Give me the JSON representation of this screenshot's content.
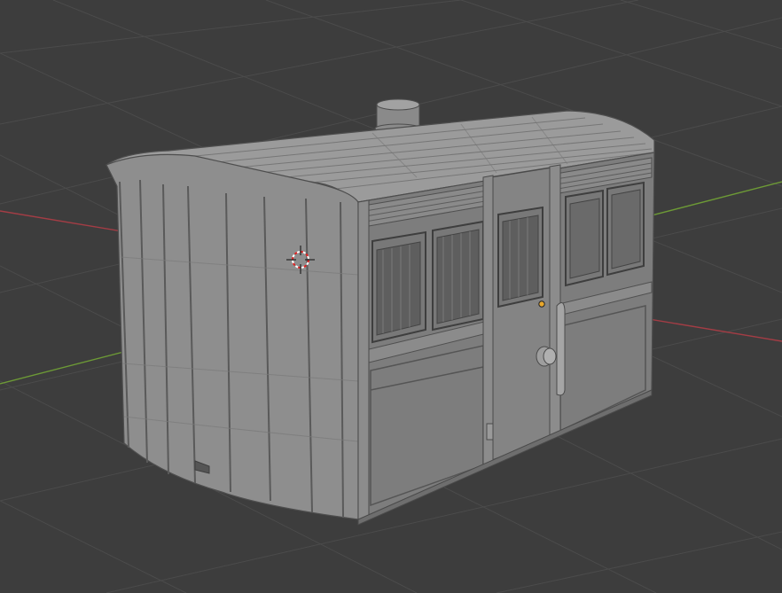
{
  "viewport": {
    "background_color": "#3d3d3d",
    "grid_color": "#4a4a4a",
    "x_axis_color": "#a33d45",
    "y_axis_color": "#6d9a36",
    "mesh_face_color": "#8d8d8d",
    "mesh_side_color": "#7b7b7b",
    "mesh_roof_color": "#9a9a9a",
    "mesh_edge_color": "#4e4e4e",
    "window_dark_color": "#3a3a3a",
    "origin_color": "#e8a72c",
    "cursor_colors": [
      "#e02020",
      "#ffffff"
    ]
  },
  "objects": [
    {
      "name": "carriage-body",
      "icon": "mesh-object"
    },
    {
      "name": "3d-cursor",
      "icon": "cursor-icon"
    },
    {
      "name": "object-origin",
      "icon": "origin-dot"
    }
  ]
}
